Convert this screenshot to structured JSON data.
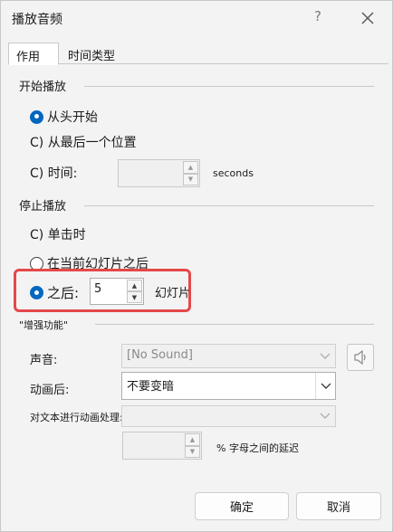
{
  "window": {
    "title": "播放音频",
    "help": "?"
  },
  "tabs": [
    {
      "label": "作用"
    },
    {
      "label": "时间类型"
    }
  ],
  "start": {
    "title": "开始播放",
    "from_beginning": "从头开始",
    "from_last_position": "C) 从最后一个位置",
    "time_label": "C) 时间:",
    "time_value": "",
    "seconds": "seconds"
  },
  "stop": {
    "title": "停止播放",
    "on_click": "C) 单击时",
    "after_current_slide": "在当前幻灯片之后",
    "after_label": "之后:",
    "after_value": "5",
    "slides_unit": "幻灯片"
  },
  "enhancements": {
    "title": "\"增强功能\"",
    "sound_label": "声音:",
    "sound_value": "[No Sound]",
    "after_animation_label": "动画后:",
    "after_animation_value": "不要变暗",
    "animate_text_label": "对文本进行动画处理:",
    "animate_text_value": "",
    "delay_value": "",
    "delay_unit": "% 字母之间的延迟"
  },
  "buttons": {
    "ok": "确定",
    "cancel": "取消"
  },
  "colors": {
    "accent": "#0067c0",
    "highlight": "#e4484a"
  }
}
